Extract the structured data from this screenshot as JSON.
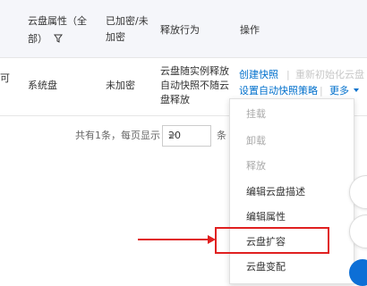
{
  "header": {
    "col_attr": "云盘属性（全",
    "col_attr2": "部）",
    "col_encrypt": "已加密/未",
    "col_encrypt2": "加密",
    "col_release": "释放行为",
    "col_ops": "操作"
  },
  "row": {
    "first_col_fragment": "可",
    "attr": "系统盘",
    "encrypt": "未加密",
    "release_line1": "云盘随实例释放",
    "release_line2": "自动快照不随云",
    "release_line3": "盘释放",
    "op_create_snapshot": "创建快照",
    "op_reinit": "重新初始化云盘",
    "op_auto_snapshot": "设置自动快照策略",
    "op_more": "更多"
  },
  "pager": {
    "text": "共有1条，每页显示：",
    "page_size": "20",
    "suffix": "条"
  },
  "menu": {
    "items": [
      {
        "label": "挂载",
        "state": "disabled"
      },
      {
        "label": "卸载",
        "state": "disabled"
      },
      {
        "label": "释放",
        "state": "disabled"
      },
      {
        "label": "编辑云盘描述",
        "state": "enabled"
      },
      {
        "label": "编辑属性",
        "state": "enabled"
      },
      {
        "label": "云盘扩容",
        "state": "enabled"
      },
      {
        "label": "云盘变配",
        "state": "enabled"
      }
    ]
  },
  "colors": {
    "link": "#0070cc",
    "annotation": "#e02020"
  }
}
